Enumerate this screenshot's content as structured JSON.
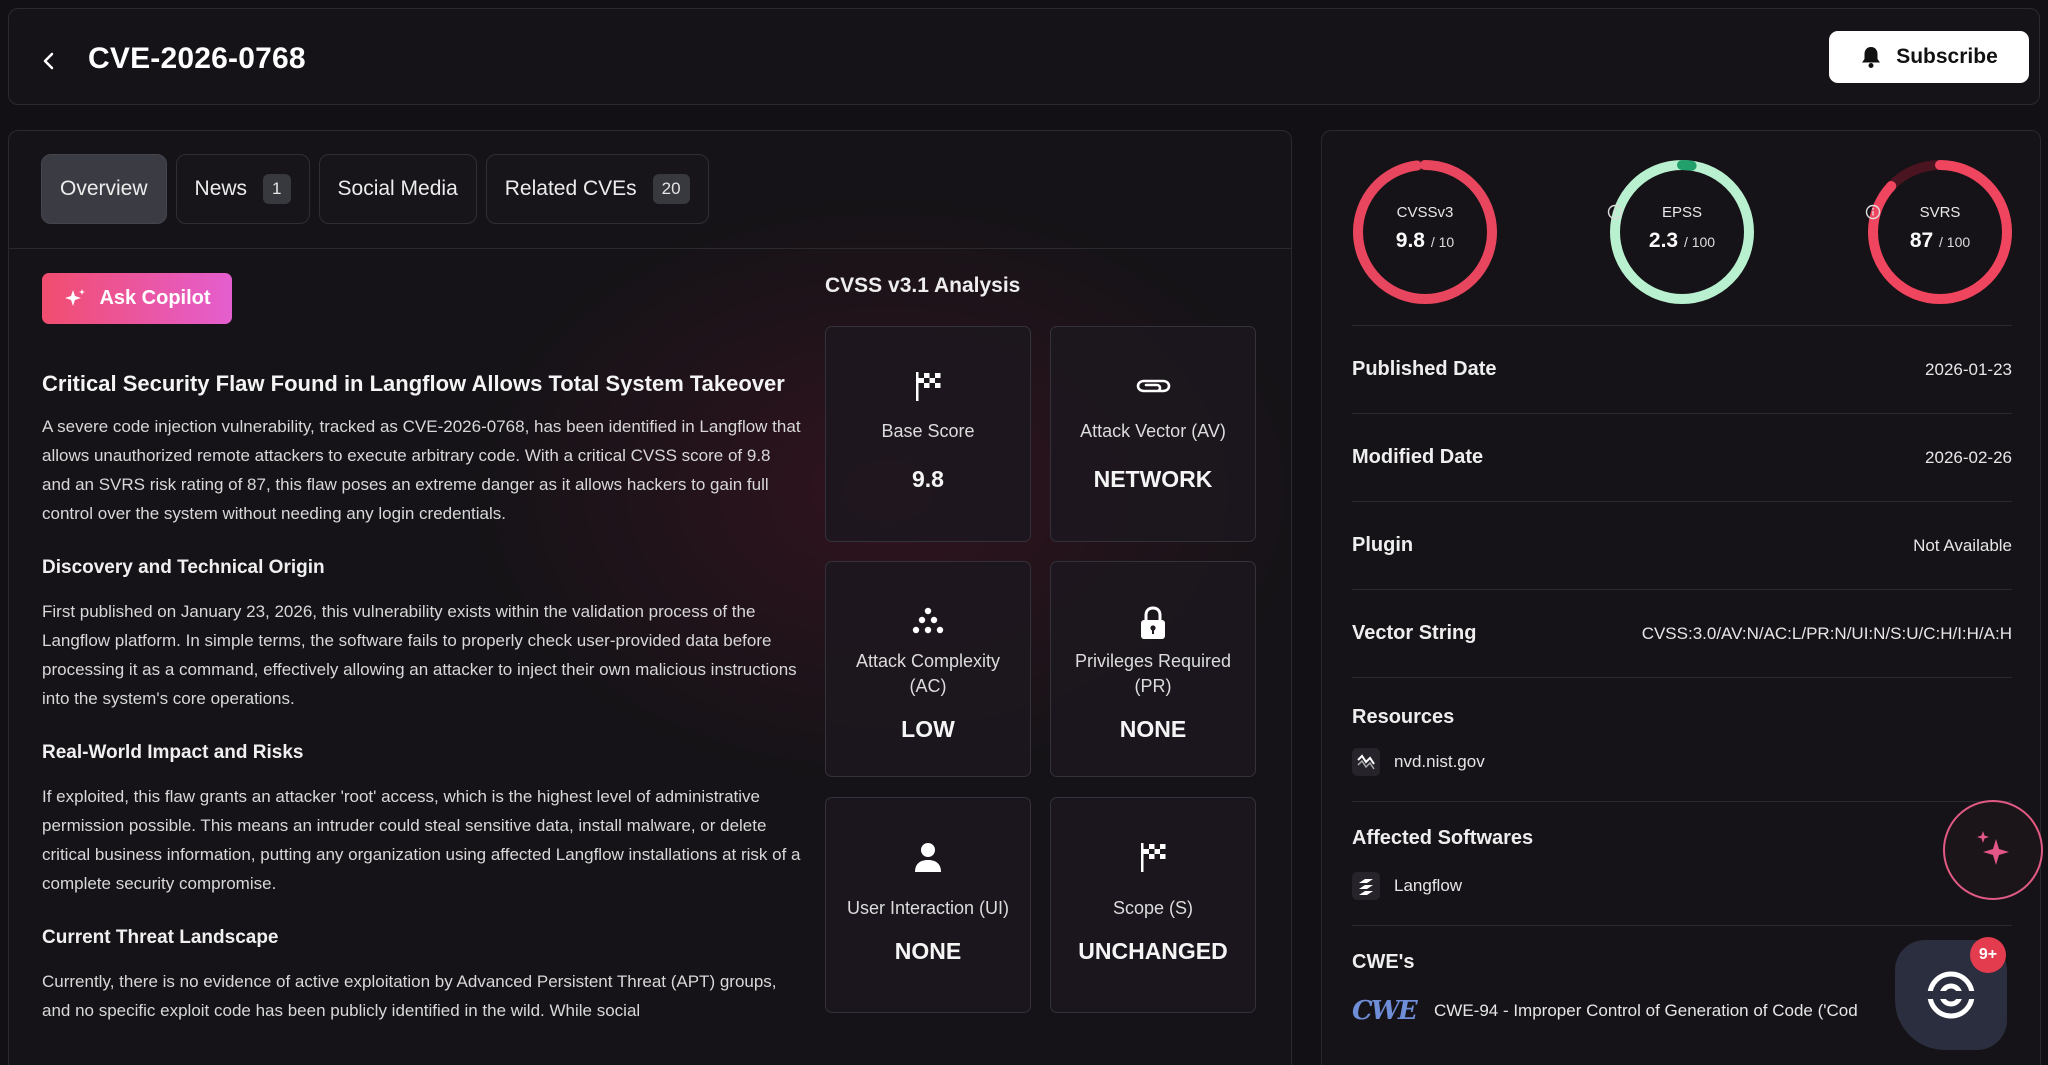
{
  "header": {
    "title": "CVE-2026-0768",
    "subscribe_label": "Subscribe"
  },
  "tabs": [
    {
      "label": "Overview",
      "count": null
    },
    {
      "label": "News",
      "count": "1"
    },
    {
      "label": "Social Media",
      "count": null
    },
    {
      "label": "Related CVEs",
      "count": "20"
    }
  ],
  "ask_copilot_label": "Ask Copilot",
  "article": {
    "title": "Critical Security Flaw Found in Langflow Allows Total System Takeover",
    "intro": "A severe code injection vulnerability, tracked as CVE-2026-0768, has been identified in Langflow that allows unauthorized remote attackers to execute arbitrary code. With a critical CVSS score of 9.8 and an SVRS risk rating of 87, this flaw poses an extreme danger as it allows hackers to gain full control over the system without needing any login credentials.",
    "sections": [
      {
        "heading": "Discovery and Technical Origin",
        "body": "First published on January 23, 2026, this vulnerability exists within the validation process of the Langflow platform. In simple terms, the software fails to properly check user-provided data before processing it as a command, effectively allowing an attacker to inject their own malicious instructions into the system's core operations."
      },
      {
        "heading": "Real-World Impact and Risks",
        "body": "If exploited, this flaw grants an attacker 'root' access, which is the highest level of administrative permission possible. This means an intruder could steal sensitive data, install malware, or delete critical business information, putting any organization using affected Langflow installations at risk of a complete security compromise."
      },
      {
        "heading": "Current Threat Landscape",
        "body": "Currently, there is no evidence of active exploitation by Advanced Persistent Threat (APT) groups, and no specific exploit code has been publicly identified in the wild. While social"
      }
    ]
  },
  "cvss_analysis": {
    "title": "CVSS v3.1 Analysis",
    "metrics": [
      {
        "label": "Base Score",
        "value": "9.8",
        "icon": "flag-icon"
      },
      {
        "label": "Attack Vector (AV)",
        "value": "NETWORK",
        "icon": "paperclip-icon"
      },
      {
        "label": "Attack Complexity (AC)",
        "value": "LOW",
        "icon": "dots-pyramid-icon"
      },
      {
        "label": "Privileges Required (PR)",
        "value": "NONE",
        "icon": "lock-icon"
      },
      {
        "label": "User Interaction (UI)",
        "value": "NONE",
        "icon": "user-icon"
      },
      {
        "label": "Scope (S)",
        "value": "UNCHANGED",
        "icon": "flag-icon"
      }
    ]
  },
  "scores": [
    {
      "name": "CVSSv3",
      "value": "9.8",
      "max": "/ 10",
      "fraction": 0.98,
      "color": "#e8465e",
      "track": "#4a1420",
      "info": false
    },
    {
      "name": "EPSS",
      "value": "2.3",
      "max": "/ 100",
      "fraction": 0.023,
      "color": "#22a06b",
      "track": "#b9f0cf",
      "info": true
    },
    {
      "name": "SVRS",
      "value": "87",
      "max": "/ 100",
      "fraction": 0.87,
      "color": "#f0455e",
      "track": "#4a1420",
      "info": true
    }
  ],
  "details": [
    {
      "key": "Published Date",
      "value": "2026-01-23"
    },
    {
      "key": "Modified Date",
      "value": "2026-02-26"
    },
    {
      "key": "Plugin",
      "value": "Not Available"
    },
    {
      "key": "Vector String",
      "value": "CVSS:3.0/AV:N/AC:L/PR:N/UI:N/S:U/C:H/I:H/A:H"
    }
  ],
  "resources": {
    "label": "Resources",
    "item": "nvd.nist.gov"
  },
  "affected": {
    "label": "Affected Softwares",
    "item": "Langflow"
  },
  "cwes": {
    "label": "CWE's",
    "logo_text": "CWE",
    "item": "CWE-94 - Improper Control of Generation of Code ('Cod"
  },
  "notification_count": "9+"
}
